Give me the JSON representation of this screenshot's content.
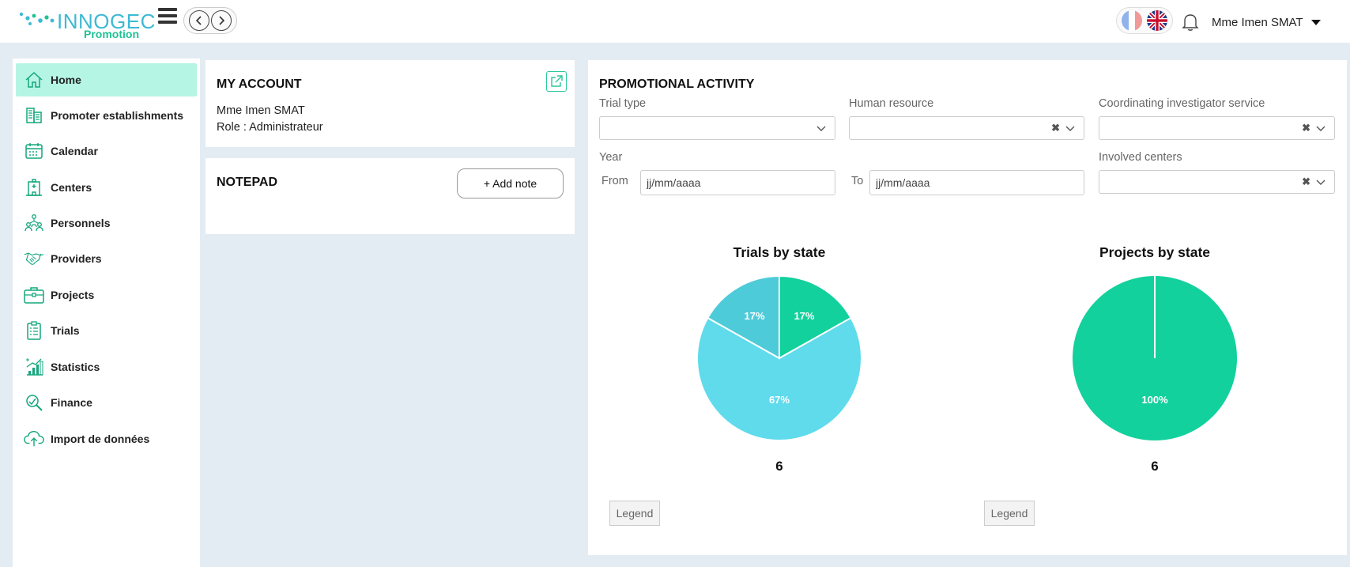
{
  "header": {
    "brand": "INNOGEC",
    "brand_sub": "Promotion",
    "user_name": "Mme Imen SMAT",
    "prev_icon": "chevron-left-icon",
    "next_icon": "chevron-right-icon",
    "bell_icon": "bell-icon",
    "flags": [
      "french-flag-icon",
      "uk-flag-icon"
    ]
  },
  "sidebar": {
    "items": [
      {
        "label": "Home",
        "icon": "home-icon",
        "active": true
      },
      {
        "label": "Promoter establishments",
        "icon": "building-icon"
      },
      {
        "label": "Calendar",
        "icon": "calendar-icon"
      },
      {
        "label": "Centers",
        "icon": "hospital-icon"
      },
      {
        "label": "Personnels",
        "icon": "people-icon"
      },
      {
        "label": "Providers",
        "icon": "handshake-icon"
      },
      {
        "label": "Projects",
        "icon": "briefcase-icon"
      },
      {
        "label": "Trials",
        "icon": "clipboard-icon"
      },
      {
        "label": "Statistics",
        "icon": "stats-icon"
      },
      {
        "label": "Finance",
        "icon": "finance-search-icon"
      },
      {
        "label": "Import de données",
        "icon": "cloud-upload-icon"
      }
    ]
  },
  "account": {
    "title": "MY ACCOUNT",
    "name": "Mme Imen SMAT",
    "role": "Role : Administrateur"
  },
  "notepad": {
    "title": "NOTEPAD",
    "add_label": "+ Add note"
  },
  "activity": {
    "title": "PROMOTIONAL ACTIVITY",
    "trial_type_label": "Trial type",
    "human_resource_label": "Human resource",
    "coord_label": "Coordinating investigator service",
    "year_label": "Year",
    "from_label": "From",
    "to_label": "To",
    "date_placeholder": "jj/mm/aaaa",
    "involved_label": "Involved centers",
    "clear_glyph": "✖",
    "legend_label": "Legend"
  },
  "colors": {
    "accent": "#1fc295",
    "green_slice": "#12d19c",
    "cyan_slice": "#5fdbeb",
    "teal_slice": "#4ecbd9",
    "active_nav": "#b5f5e4"
  },
  "chart_data": [
    {
      "type": "pie",
      "title": "Trials by state",
      "total": "6",
      "slices": [
        {
          "label": "17%",
          "value": 17,
          "color": "#12d19c"
        },
        {
          "label": "67%",
          "value": 67,
          "color": "#5fdbeb"
        },
        {
          "label": "17%",
          "value": 17,
          "color": "#4ecbd9"
        }
      ]
    },
    {
      "type": "pie",
      "title": "Projects by state",
      "total": "6",
      "slices": [
        {
          "label": "100%",
          "value": 100,
          "color": "#12d19c"
        }
      ]
    }
  ]
}
